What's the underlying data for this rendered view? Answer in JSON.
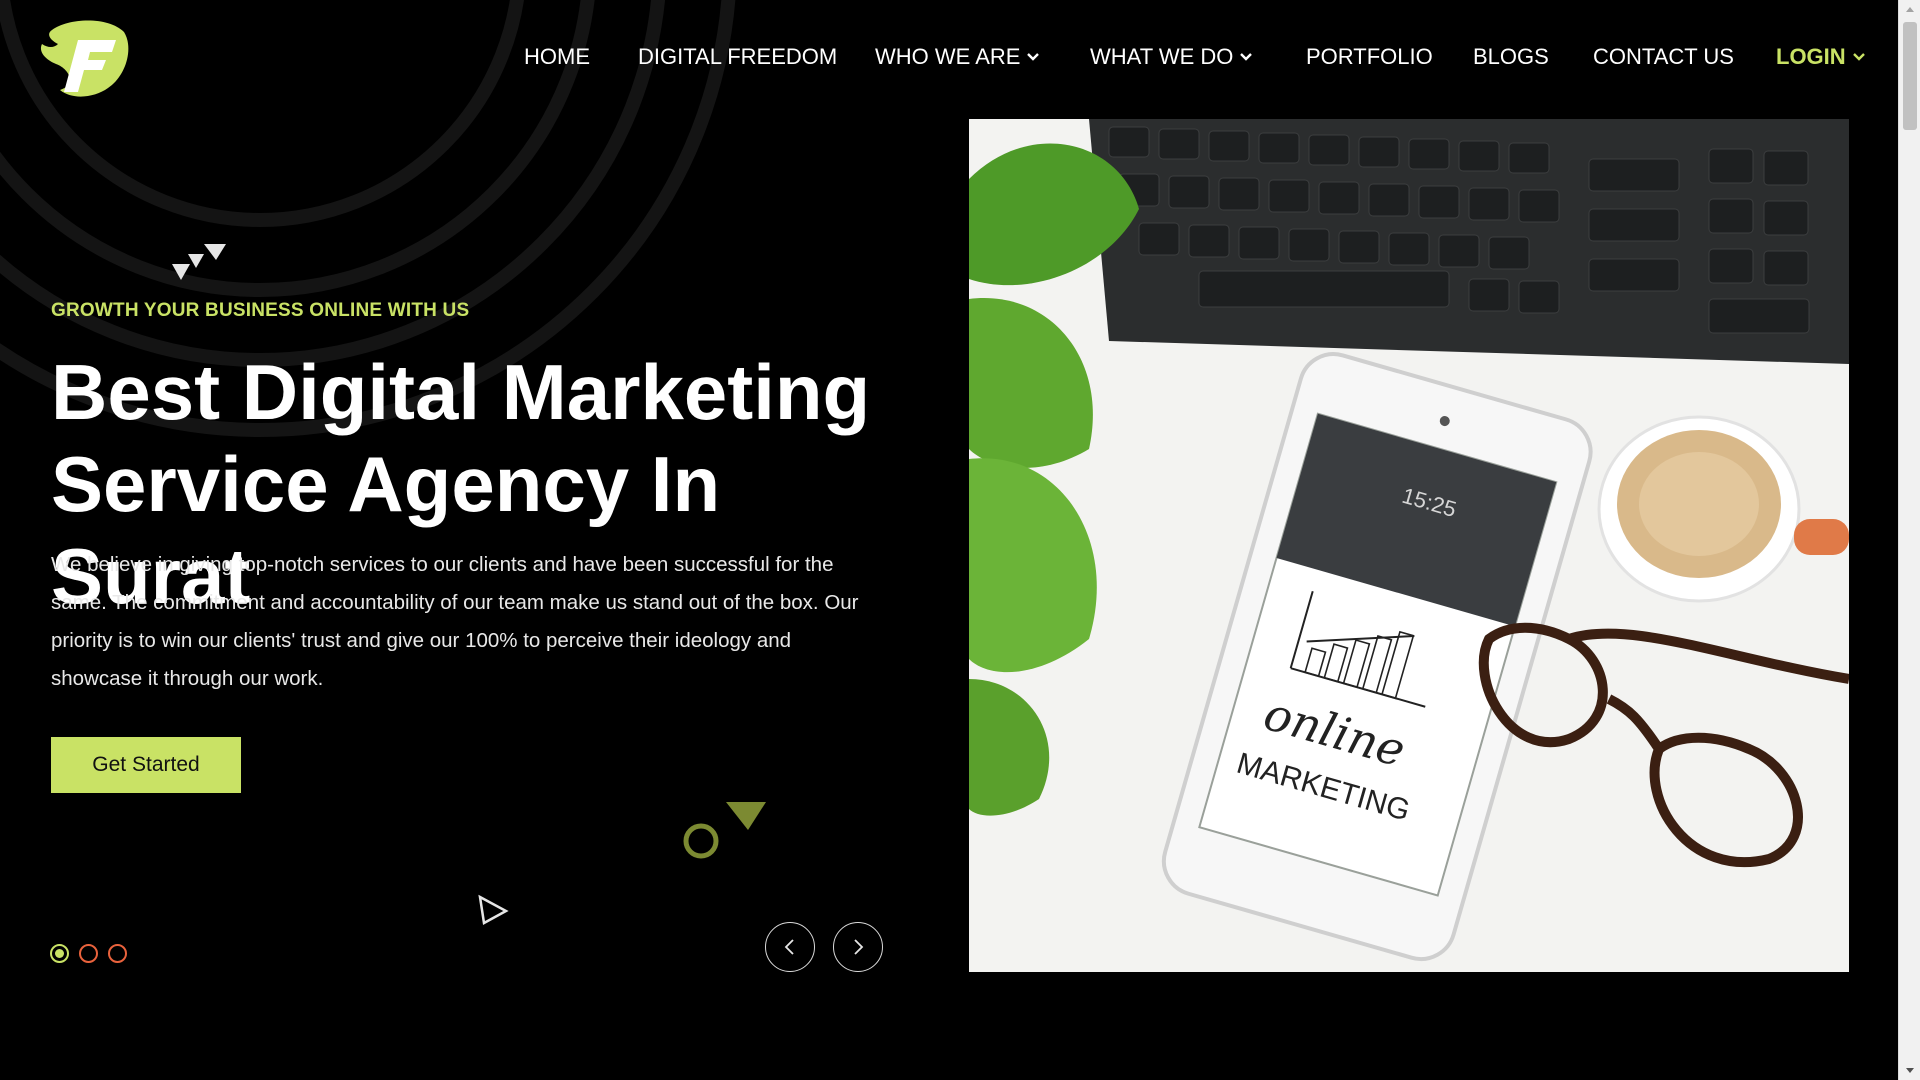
{
  "brand": {
    "logo_icon": "leaf-f-logo-icon",
    "accent": "#c9e265",
    "secondary_accent": "#e9623c"
  },
  "nav": {
    "items": [
      {
        "label": "HOME",
        "dropdown": false
      },
      {
        "label": "DIGITAL FREEDOM",
        "dropdown": false
      },
      {
        "label": "WHO WE ARE",
        "dropdown": true
      },
      {
        "label": "WHAT WE DO",
        "dropdown": true
      },
      {
        "label": "PORTFOLIO",
        "dropdown": false
      },
      {
        "label": "BLOGS",
        "dropdown": false
      },
      {
        "label": "CONTACT US",
        "dropdown": false
      },
      {
        "label": "LOGIN",
        "dropdown": true,
        "highlight": true
      }
    ]
  },
  "hero": {
    "eyebrow": "GROWTH YOUR BUSINESS ONLINE WITH US",
    "headline_line1": "Best Digital Marketing",
    "headline_line2": "Service Agency In Surat",
    "body": "We believe in giving top-notch services to our clients and have been successful for the same. The commitment and accountability of our team make us stand out of the box. Our priority is to win our clients' trust and give our 100% to perceive their ideology and showcase it through our work.",
    "cta_label": "Get Started",
    "image": {
      "phone_text_1": "online",
      "phone_text_2": "MARKETING",
      "phone_clock": "15:25"
    }
  },
  "slider": {
    "slide_count": 3,
    "active_index": 0,
    "prev_icon": "chevron-left-icon",
    "next_icon": "chevron-right-icon"
  }
}
